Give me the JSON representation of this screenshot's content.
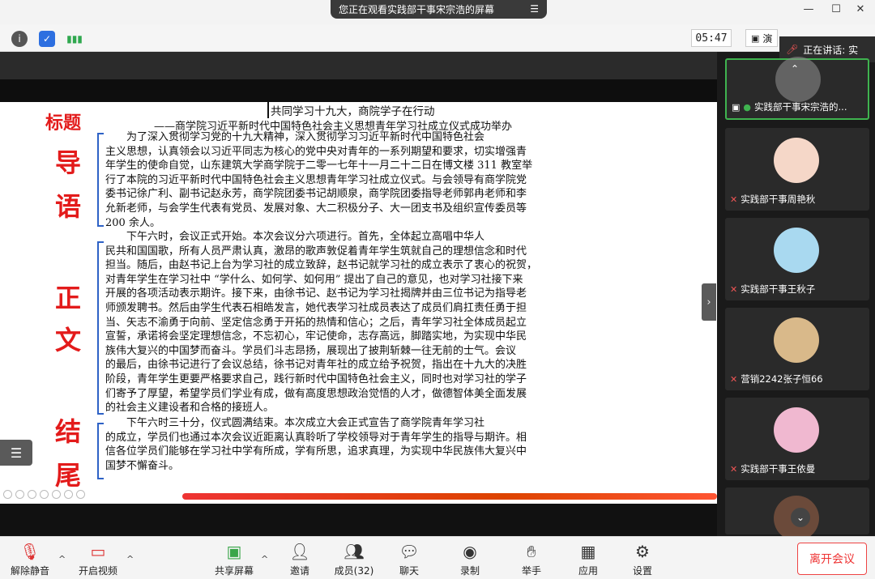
{
  "window": {
    "share_banner": "您正在观看实践部干事宋宗浩的屏幕",
    "minimize": "—",
    "maximize": "☐",
    "close": "✕"
  },
  "toolbar": {
    "timer": "05:47",
    "view_label": "演"
  },
  "speaking": {
    "label": "正在讲话: 实"
  },
  "slide": {
    "labels": {
      "title": "标题",
      "lead": [
        "导",
        "语"
      ],
      "body": [
        "正",
        "文"
      ],
      "end": [
        "结",
        "尾"
      ]
    },
    "doc_title": "共同学习十九大，商院学子在行动",
    "doc_subtitle": "——商学院习近平新时代中国特色社会主义思想青年学习社成立仪式成功举办",
    "lead_lines": [
      "　　为了深入贯彻学习党的十九大精神，深入贯彻学习习近平新时代中国特色社会",
      "主义思想，认真领会以习近平同志为核心的党中央对青年的一系列期望和要求，切实增强青",
      "年学生的使命自觉，山东建筑大学商学院于二零一七年十一月二十二日在博文楼 311 教室举",
      "行了本院的习近平新时代中国特色社会主义思想青年学习社成立仪式。与会领导有商学院党",
      "委书记徐广利、副书记赵永芳，商学院团委书记胡顺泉，商学院团委指导老师郭冉老师和李",
      "允新老师，与会学生代表有党员、发展对象、大二积极分子、大一团支书及组织宣传委员等",
      "200 余人。"
    ],
    "body_lines": [
      "　　下午六时，会议正式开始。本次会议分六项进行。首先，全体起立高唱中华人",
      "民共和国国歌，所有人员严肃认真，激昂的歌声敦促着青年学生筑就自己的理想信念和时代",
      "担当。随后，由赵书记上台为学习社的成立致辞，赵书记就学习社的成立表示了衷心的祝贺，",
      "对青年学生在学习社中 “学什么、如何学、如何用” 提出了自己的意见，也对学习社接下来",
      "开展的各项活动表示期许。接下来，由徐书记、赵书记为学习社揭牌并由三位书记为指导老",
      "师颁发聘书。然后由学生代表石相皓发言，她代表学习社成员表达了成员们肩扛责任勇于担",
      "当、矢志不渝勇于向前、坚定信念勇于开拓的热情和信心；之后，青年学习社全体成员起立",
      "宣誓，承诺将会坚定理想信念，不忘初心，牢记使命，志存高远，脚踏实地，为实现中华民",
      "族伟大复兴的中国梦而奋斗。学员们斗志昂扬，展现出了披荆斩棘一往无前的士气。会议",
      "的最后，由徐书记进行了会议总结，徐书记对青年社的成立给予祝贺，指出在十九大的决胜",
      "阶段，青年学生更要严格要求自己，践行新时代中国特色社会主义，同时也对学习社的学子",
      "们寄予了厚望，希望学员们学业有成，做有高度思想政治觉悟的人才，做德智体美全面发展",
      "的社会主义建设者和合格的接班人。"
    ],
    "end_lines": [
      "　　下午六时三十分，仪式圆满结束。本次成立大会正式宣告了商学院青年学习社",
      "的成立，学员们也通过本次会议近距离认真聆听了学校领导对于青年学生的指导与期许。相",
      "信各位学员们能够在学习社中学有所成，学有所思，追求真理，为实现中华民族伟大复兴中",
      "国梦不懈奋斗。"
    ]
  },
  "participants": [
    {
      "name": "实践部干事宋宗浩的...",
      "muted": false,
      "active": true
    },
    {
      "name": "实践部干事周艳秋",
      "muted": true,
      "avatar_color": "#f5d7c8"
    },
    {
      "name": "实践部干事王秋子",
      "muted": true,
      "avatar_color": "#a9d9f0"
    },
    {
      "name": "营销2242张子恒66",
      "muted": true,
      "avatar_color": "#d9b98a"
    },
    {
      "name": "实践部干事王依曼",
      "muted": true,
      "avatar_color": "#f0b8d0"
    }
  ],
  "controls": {
    "unmute": "解除静音",
    "start_video": "开启视频",
    "share_screen": "共享屏幕",
    "invite": "邀请",
    "members": "成员(32)",
    "chat": "聊天",
    "record": "录制",
    "raise_hand": "举手",
    "apps": "应用",
    "settings": "设置",
    "leave": "离开会议"
  }
}
